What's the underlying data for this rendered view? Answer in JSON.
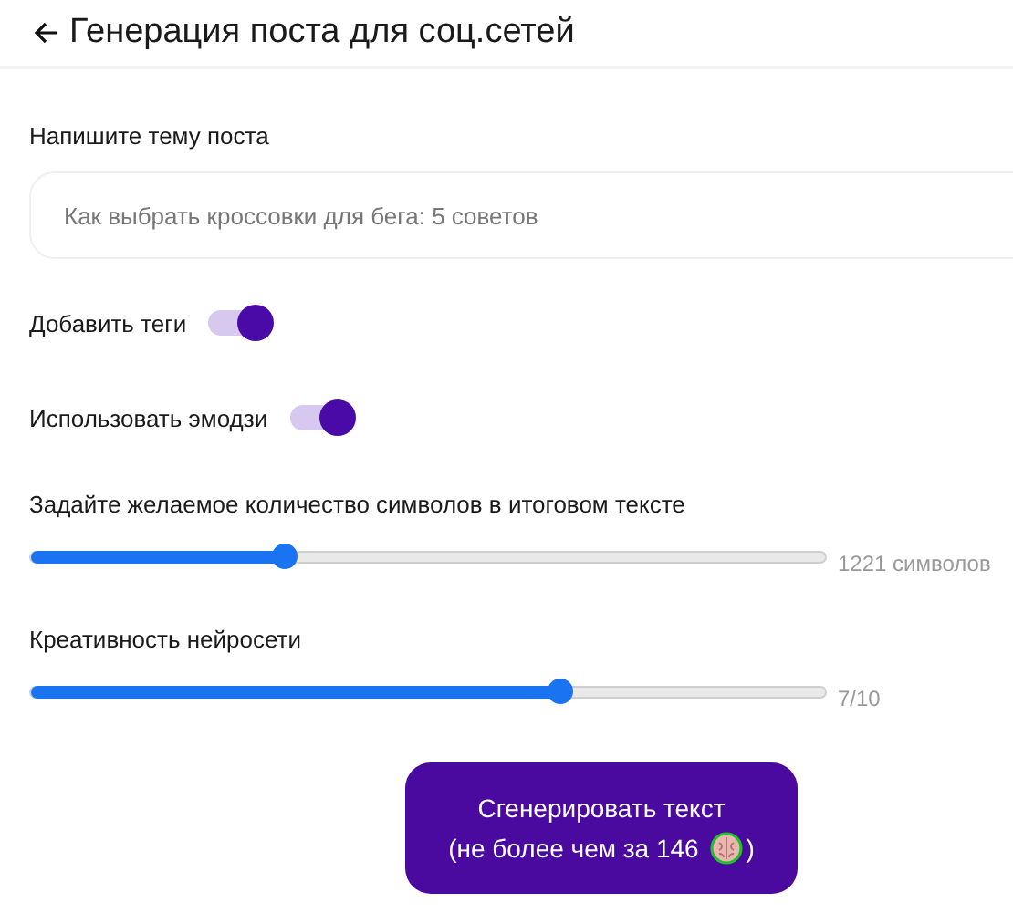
{
  "header": {
    "title": "Генерация поста для соц.сетей"
  },
  "topic": {
    "label": "Напишите тему поста",
    "placeholder": "Как выбрать кроссовки для бега: 5 советов"
  },
  "toggles": [
    {
      "label": "Добавить теги",
      "on": true
    },
    {
      "label": "Использовать эмодзи",
      "on": true
    }
  ],
  "sliders": [
    {
      "label": "Задайте желаемое количество символов в итоговом тексте",
      "level": 0.32,
      "reading": "1221 символов"
    },
    {
      "label": "Креативность нейросети",
      "level": 0.667,
      "reading": "7/10"
    }
  ],
  "generate_button": {
    "line1": "Сгенерировать текст",
    "line2_prefix": "(не более чем за 146",
    "line2_suffix": ")"
  }
}
